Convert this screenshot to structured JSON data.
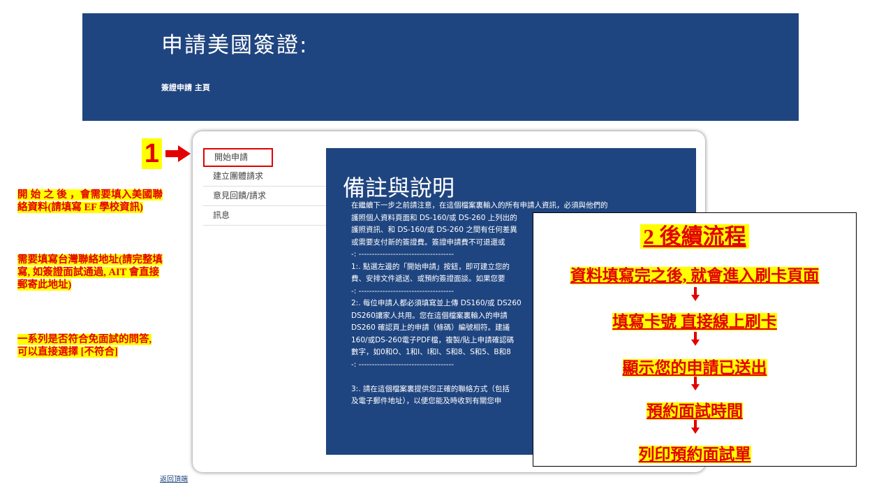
{
  "header": {
    "title": "申請美國簽證:",
    "breadcrumb": "簽證申請 主頁"
  },
  "annotation": {
    "step_number": "1",
    "notes": [
      "開 始 之 後 ，會需要填入美國聯絡資料(請填寫 EF 學校資訊)",
      "需要填寫台灣聯絡地址(請完整填寫, 如簽證面試通過, AIT 會直接郵寄此地址)",
      "一系列是否符合免面試的問答, 可以直接選擇 [不符合]"
    ]
  },
  "sidebar": {
    "items": [
      {
        "label": "開始申請"
      },
      {
        "label": "建立團體請求"
      },
      {
        "label": "意見回饋/請求"
      },
      {
        "label": "訊息"
      }
    ]
  },
  "main": {
    "heading": "備註與說明",
    "body": "在繼續下一步之前請注意，在這個檔案裏輸入的所有申請人資訊，必須與他們的\n護照個人資料頁面和 DS-160/或 DS-260 上列出的\n護照資訊、和 DS-160/或 DS-260 之間有任何差異\n或需要支付新的簽證費。簽證申請費不可退還或\n-: ------------------------------------\n1:. 點選左邊的「開始申請」按鈕，即可建立您的\n費、安排文件遞送、或預約簽證面談。如果您要\n-: ------------------------------------\n2:. 每位申請人都必須填寫並上傳 DS160/或 DS260\nDS260讓家人共用。您在這個檔案裏輸入的申請\nDS260 確認頁上的申請（條碼）編號相符。建議\n160/或DS-260電子PDF檔，複製/貼上申請確認碼\n數字，如0和O、1和I、I和l、S和8、S和5、B和8\n-: ------------------------------------\n\n3:. 請在這個檔案裏提供您正確的聯絡方式（包括\n及電子郵件地址），以便您能及時收到有關您申"
  },
  "process": {
    "title": "2 後續流程",
    "steps": [
      "資料填寫完之後, 就會進入刷卡頁面",
      "填寫卡號 直接線上刷卡",
      "顯示您的申請已送出",
      "預約面試時間",
      "列印預約面試單"
    ]
  },
  "footer": {
    "back_to_top": "返回頂端"
  },
  "colors": {
    "banner": "#1f4580",
    "highlight": "#ffff00",
    "annotation_red": "#e30000"
  }
}
